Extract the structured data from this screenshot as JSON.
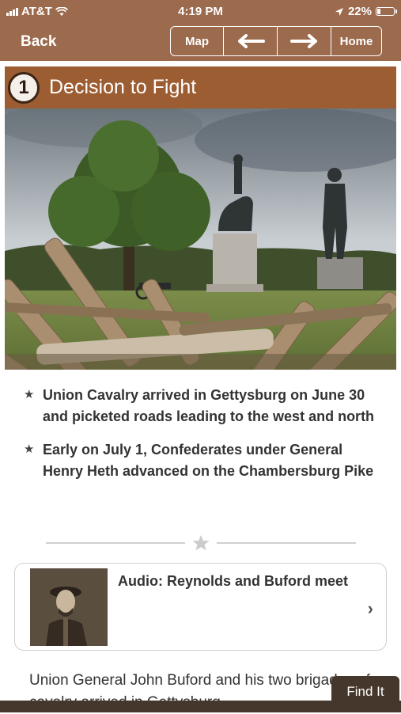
{
  "status_bar": {
    "carrier": "AT&T",
    "time": "4:19 PM",
    "battery_percent": "22%",
    "battery_level": 0.22
  },
  "nav": {
    "back_label": "Back",
    "map_label": "Map",
    "prev_icon": "arrow-left-icon",
    "next_icon": "arrow-right-icon",
    "home_label": "Home"
  },
  "stop": {
    "number": "1",
    "title": "Decision to Fight"
  },
  "bullets": [
    "Union Cavalry arrived in Gettysburg on June 30 and picketed roads leading to the west and north",
    "Early on July 1, Confederates under General Henry Heth advanced on the Chambersburg Pike"
  ],
  "audio": {
    "title": "Audio: Reynolds and Buford meet"
  },
  "body_text": "Union General John Buford and his two brigades of cavalry arrived in Gettysburg",
  "find_it_label": "Find It",
  "colors": {
    "header": "#9c6a4d",
    "title_bar": "#9c5d32",
    "find_it": "#46372c"
  }
}
